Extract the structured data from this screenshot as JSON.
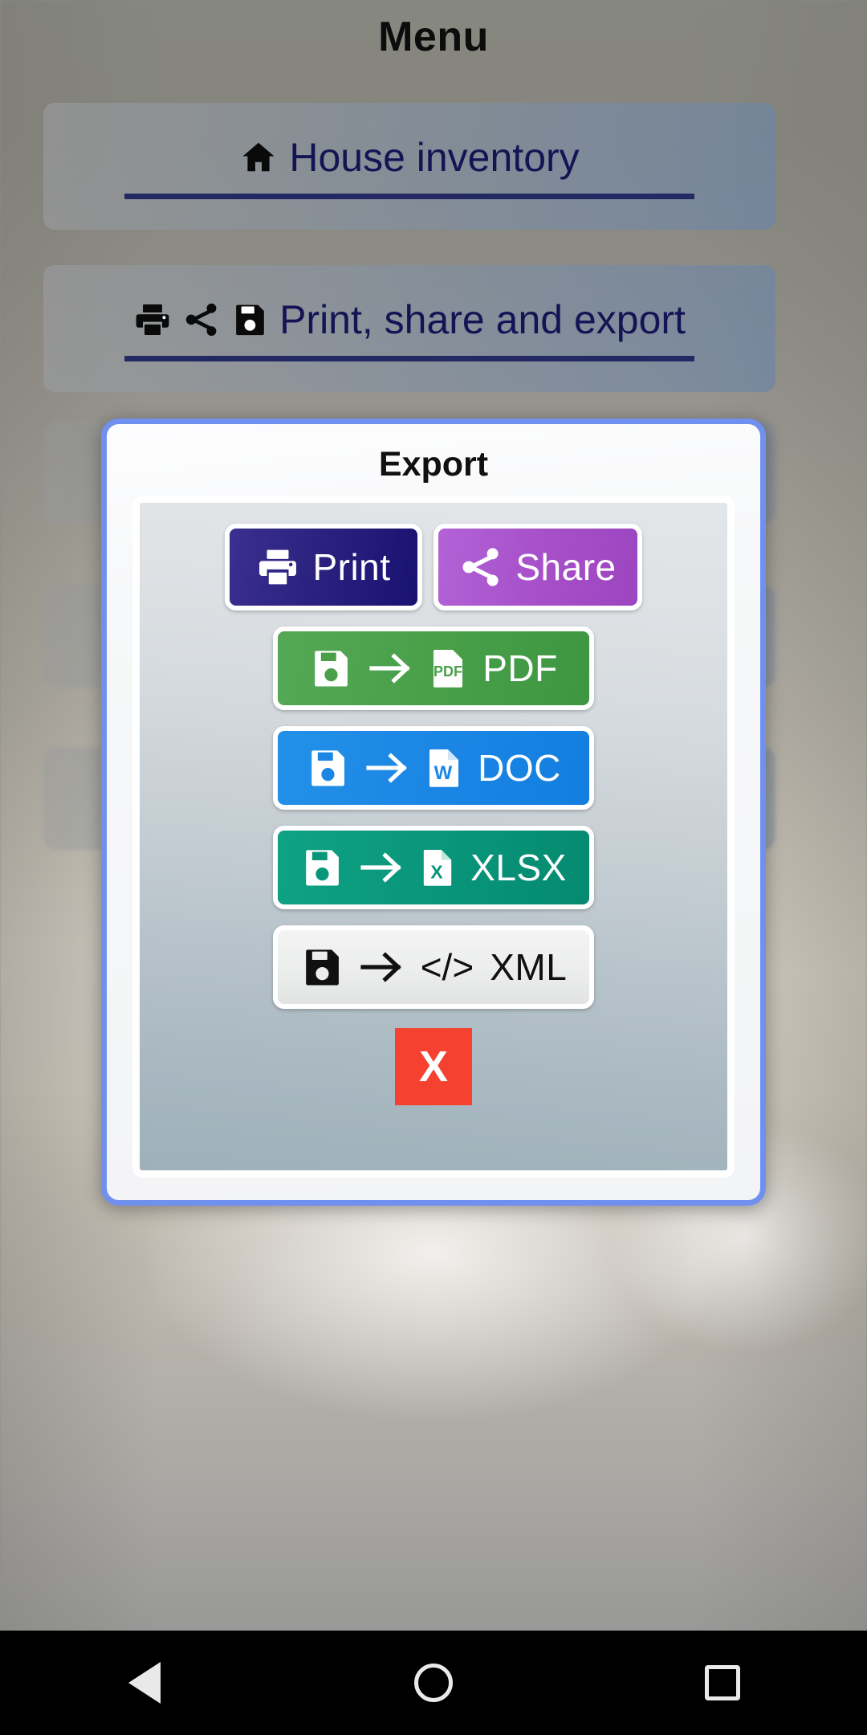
{
  "header": {
    "title": "Menu"
  },
  "menu": {
    "items": [
      {
        "id": "house-inventory",
        "label": "House inventory",
        "icons": [
          "home-icon"
        ]
      },
      {
        "id": "print-share-export",
        "label": "Print, share and export",
        "icons": [
          "print-icon",
          "share-icon",
          "save-icon"
        ]
      }
    ]
  },
  "dialog": {
    "title": "Export",
    "actions": [
      {
        "id": "print",
        "label": "Print",
        "icon": "print-icon",
        "color": "#2b2280"
      },
      {
        "id": "share",
        "label": "Share",
        "icon": "share-icon",
        "color": "#a750c9"
      }
    ],
    "exports": [
      {
        "id": "pdf",
        "label": "PDF",
        "badge": "PDF",
        "icon": "save-icon",
        "arrow": "arrow-right-icon",
        "color": "#49a049"
      },
      {
        "id": "doc",
        "label": "DOC",
        "badge": "W",
        "icon": "save-icon",
        "arrow": "arrow-right-icon",
        "color": "#1b86e4"
      },
      {
        "id": "xlsx",
        "label": "XLSX",
        "badge": "X",
        "icon": "save-icon",
        "arrow": "arrow-right-icon",
        "color": "#09967a"
      },
      {
        "id": "xml",
        "label": "XML",
        "badge": "</>",
        "icon": "save-icon",
        "arrow": "arrow-right-icon",
        "color": "#ececec"
      }
    ],
    "close": {
      "label": "X",
      "color": "#f5412f"
    }
  },
  "navbar": {
    "items": [
      {
        "id": "back",
        "icon": "triangle-back-icon"
      },
      {
        "id": "home",
        "icon": "circle-home-icon"
      },
      {
        "id": "recents",
        "icon": "square-recents-icon"
      }
    ]
  }
}
